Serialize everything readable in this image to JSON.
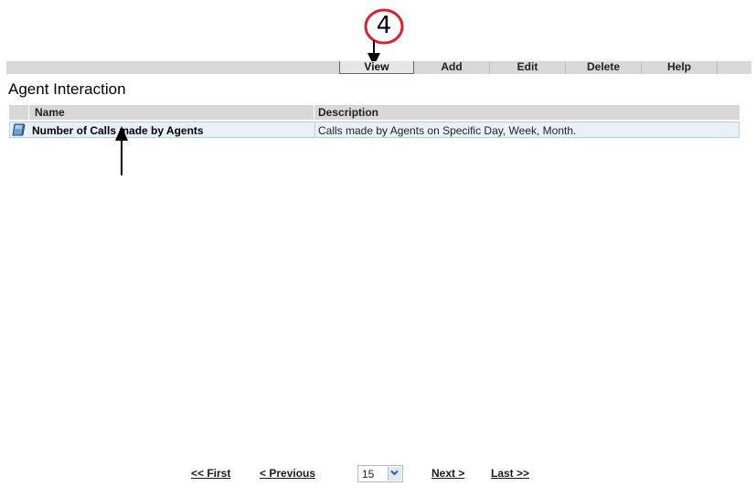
{
  "callout": {
    "number": "4"
  },
  "toolbar": {
    "buttons": [
      {
        "label": "View",
        "active": true
      },
      {
        "label": "Add",
        "active": false
      },
      {
        "label": "Edit",
        "active": false
      },
      {
        "label": "Delete",
        "active": false
      },
      {
        "label": "Help",
        "active": false
      }
    ]
  },
  "section": {
    "title": "Agent Interaction"
  },
  "table": {
    "headers": {
      "name": "Name",
      "description": "Description"
    },
    "rows": [
      {
        "icon": "book-icon",
        "name": "Number of Calls made by Agents",
        "description": "Calls made by Agents on Specific Day, Week, Month."
      }
    ]
  },
  "pager": {
    "first": "<< First",
    "previous": "< Previous",
    "page_size": "15",
    "next": "Next >",
    "last": "Last >>"
  },
  "colors": {
    "callout_ring": "#d9232e",
    "toolbar_bg": "#d8d8d8",
    "row_bg": "#e8f1f9"
  }
}
